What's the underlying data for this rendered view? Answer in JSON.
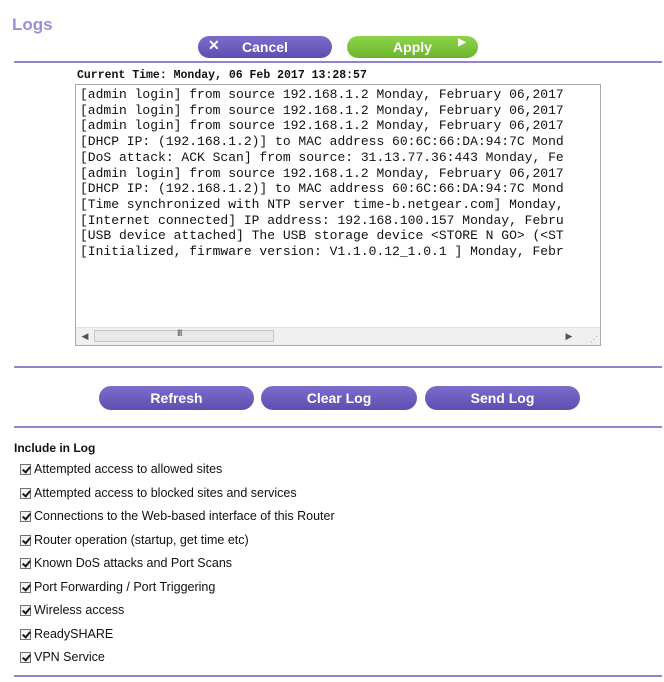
{
  "page": {
    "title": "Logs",
    "buttons": {
      "cancel": "Cancel",
      "apply": "Apply"
    },
    "current_time": "Current Time: Monday, 06 Feb 2017 13:28:57"
  },
  "log": {
    "lines": [
      "[admin login] from source 192.168.1.2 Monday, February 06,2017",
      "[admin login] from source 192.168.1.2 Monday, February 06,2017",
      "[admin login] from source 192.168.1.2 Monday, February 06,2017",
      "[DHCP IP: (192.168.1.2)] to MAC address 60:6C:66:DA:94:7C Mond",
      "[DoS attack: ACK Scan] from source: 31.13.77.36:443 Monday, Fe",
      "[admin login] from source 192.168.1.2 Monday, February 06,2017",
      "[DHCP IP: (192.168.1.2)] to MAC address 60:6C:66:DA:94:7C Mond",
      "[Time synchronized with NTP server time-b.netgear.com] Monday,",
      "[Internet connected] IP address: 192.168.100.157 Monday, Febru",
      "[USB device attached] The USB storage device <STORE N GO> (<ST",
      "[Initialized, firmware version: V1.1.0.12_1.0.1 ] Monday, Febr"
    ],
    "scroll_grip": "III"
  },
  "actions": {
    "refresh": "Refresh",
    "clear": "Clear Log",
    "send": "Send Log"
  },
  "include": {
    "title": "Include in Log",
    "options": [
      {
        "label": "Attempted access to allowed sites",
        "checked": true
      },
      {
        "label": "Attempted access to blocked sites and services",
        "checked": true
      },
      {
        "label": "Connections to the Web-based interface of this Router",
        "checked": true
      },
      {
        "label": "Router operation (startup, get time etc)",
        "checked": true
      },
      {
        "label": "Known DoS attacks and Port Scans",
        "checked": true
      },
      {
        "label": "Port Forwarding / Port Triggering",
        "checked": true
      },
      {
        "label": "Wireless access",
        "checked": true
      },
      {
        "label": "ReadySHARE",
        "checked": true
      },
      {
        "label": "VPN Service",
        "checked": true
      }
    ]
  },
  "colors": {
    "accent": "#9b8fd8",
    "button_purple": "#6a5dbf",
    "button_green": "#7cc63b",
    "rule": "#8f86cf"
  }
}
